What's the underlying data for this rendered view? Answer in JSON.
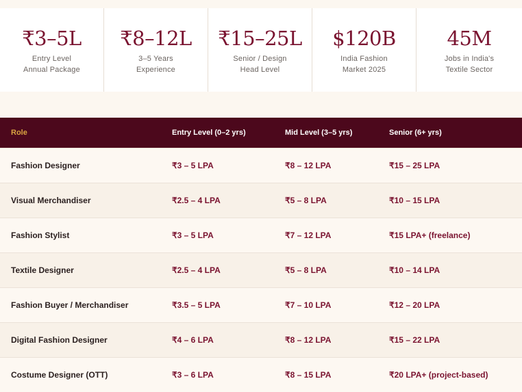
{
  "stats": [
    {
      "value": "₹3–5L",
      "label_line1": "Entry Level",
      "label_line2": "Annual Package"
    },
    {
      "value": "₹8–12L",
      "label_line1": "3–5 Years",
      "label_line2": "Experience"
    },
    {
      "value": "₹15–25L",
      "label_line1": "Senior / Design",
      "label_line2": "Head Level"
    },
    {
      "value": "$120B",
      "label_line1": "India Fashion",
      "label_line2": "Market 2025"
    },
    {
      "value": "45M",
      "label_line1": "Jobs in India's",
      "label_line2": "Textile Sector"
    }
  ],
  "table": {
    "headers": [
      "Role",
      "Entry Level (0–2 yrs)",
      "Mid Level (3–5 yrs)",
      "Senior (6+ yrs)"
    ],
    "rows": [
      [
        "Fashion Designer",
        "₹3 – 5 LPA",
        "₹8 – 12 LPA",
        "₹15 – 25 LPA"
      ],
      [
        "Visual Merchandiser",
        "₹2.5 – 4 LPA",
        "₹5 – 8 LPA",
        "₹10 – 15 LPA"
      ],
      [
        "Fashion Stylist",
        "₹3 – 5 LPA",
        "₹7 – 12 LPA",
        "₹15 LPA+ (freelance)"
      ],
      [
        "Textile Designer",
        "₹2.5 – 4 LPA",
        "₹5 – 8 LPA",
        "₹10 – 14 LPA"
      ],
      [
        "Fashion Buyer / Merchandiser",
        "₹3.5 – 5 LPA",
        "₹7 – 10 LPA",
        "₹12 – 20 LPA"
      ],
      [
        "Digital Fashion Designer",
        "₹4 – 6 LPA",
        "₹8 – 12 LPA",
        "₹15 – 22 LPA"
      ],
      [
        "Costume Designer (OTT)",
        "₹3 – 6 LPA",
        "₹8 – 15 LPA",
        "₹20 LPA+ (project-based)"
      ]
    ]
  }
}
